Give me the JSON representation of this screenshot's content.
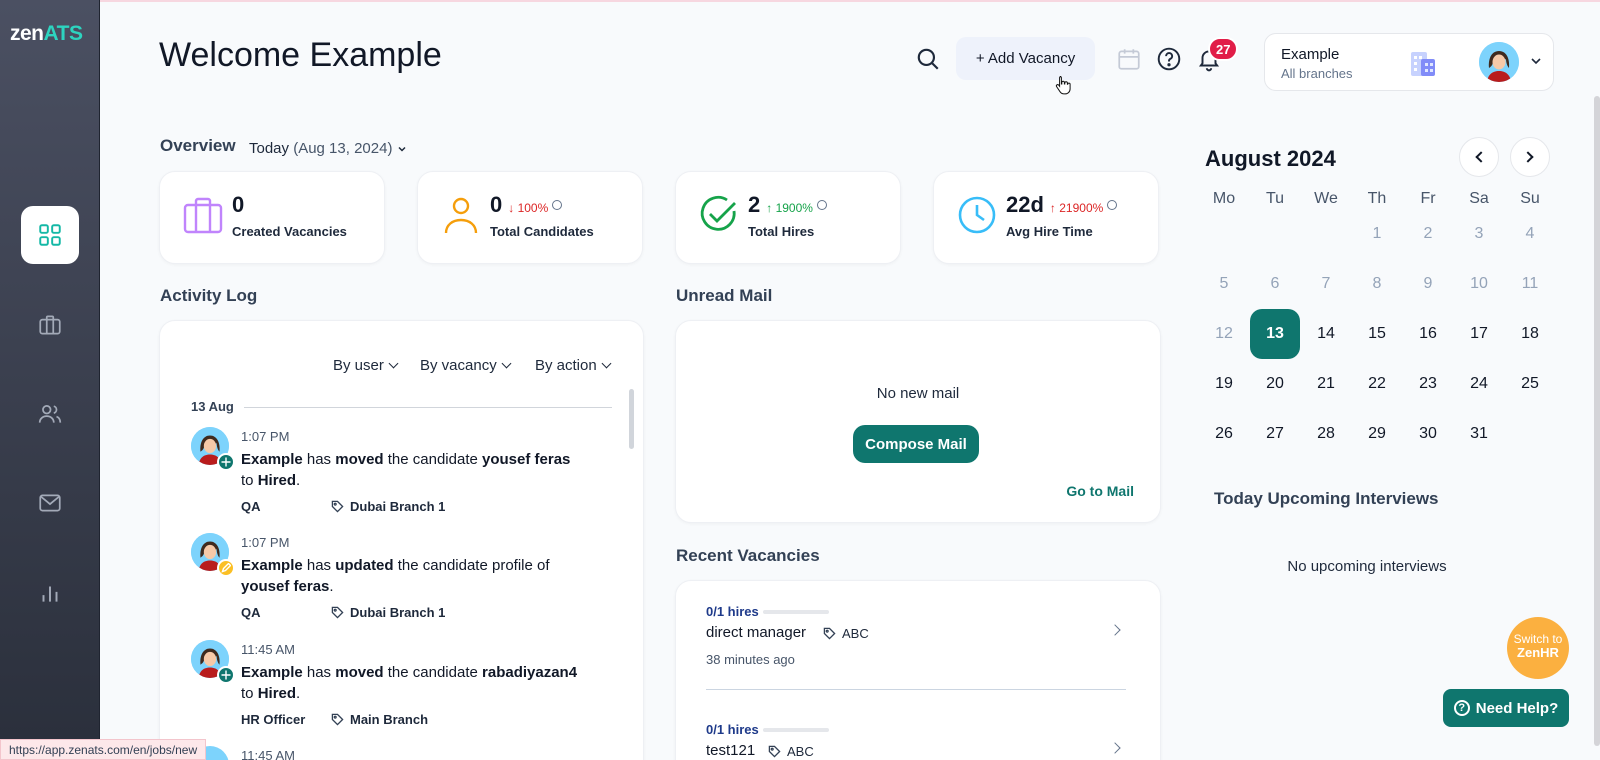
{
  "app": {
    "logo_main": "zen",
    "logo_accent": "ATS"
  },
  "header": {
    "title": "Welcome Example",
    "add_vacancy_label": "+ Add Vacancy",
    "notification_count": "27",
    "account_name": "Example",
    "account_scope": "All branches"
  },
  "overview": {
    "title": "Overview",
    "period": "Today",
    "date": "(Aug 13, 2024)",
    "stats": [
      {
        "value": "0",
        "label": "Created Vacancies",
        "change": ""
      },
      {
        "value": "0",
        "label": "Total Candidates",
        "change": "↓ 100%"
      },
      {
        "value": "2",
        "label": "Total Hires",
        "change": "↑ 1900%"
      },
      {
        "value": "22d",
        "label": "Avg Hire Time",
        "change": "↑ 21900%"
      }
    ]
  },
  "activity": {
    "title": "Activity Log",
    "filters": [
      "By user",
      "By vacancy",
      "By action"
    ],
    "day": "13 Aug",
    "entries": [
      {
        "time": "1:07 PM",
        "actor": "Example",
        "t1": " has ",
        "verb": "moved",
        "t2": " the candidate ",
        "target": "yousef feras",
        "t3": " to ",
        "stage": "Hired",
        "t4": ".",
        "role": "QA",
        "branch": "Dubai Branch 1"
      },
      {
        "time": "1:07 PM",
        "actor": "Example",
        "t1": " has ",
        "verb": "updated",
        "t2": " the candidate profile of ",
        "target": "yousef feras",
        "t3": ".",
        "stage": "",
        "t4": "",
        "role": "QA",
        "branch": "Dubai Branch 1"
      },
      {
        "time": "11:45 AM",
        "actor": "Example",
        "t1": " has ",
        "verb": "moved",
        "t2": " the candidate ",
        "target": "rabadiyazan4",
        "t3": " to ",
        "stage": "Hired",
        "t4": ".",
        "role": "HR Officer",
        "branch": "Main Branch"
      },
      {
        "time": "11:45 AM"
      }
    ]
  },
  "mail": {
    "title": "Unread Mail",
    "empty_text": "No new mail",
    "compose_label": "Compose Mail",
    "goto_label": "Go to Mail"
  },
  "vacancies": {
    "title": "Recent Vacancies",
    "items": [
      {
        "hires": "0/1 hires",
        "fill": 0.0,
        "name": "direct manager",
        "tag": "ABC",
        "ago": "38 minutes ago"
      },
      {
        "hires": "0/1 hires",
        "fill": 0.0,
        "name": "test121",
        "tag": "ABC",
        "ago": ""
      }
    ]
  },
  "calendar": {
    "title": "August 2024",
    "weekdays": [
      "Mo",
      "Tu",
      "We",
      "Th",
      "Fr",
      "Sa",
      "Su"
    ],
    "days_in_month": 31,
    "first_weekday_index": 3,
    "today": 13
  },
  "interviews": {
    "title": "Today Upcoming Interviews",
    "empty_text": "No upcoming interviews"
  },
  "widgets": {
    "switch_line1": "Switch to",
    "switch_line2": "ZenHR",
    "help_label": "Need Help?"
  },
  "status_bar": {
    "url": "https://app.zenats.com/en/jobs/new"
  },
  "colors": {
    "accent": "#0f766e",
    "sidebar_top": "#4b5062",
    "sidebar_bottom": "#2a2f3b",
    "badge": "#e11d48"
  }
}
